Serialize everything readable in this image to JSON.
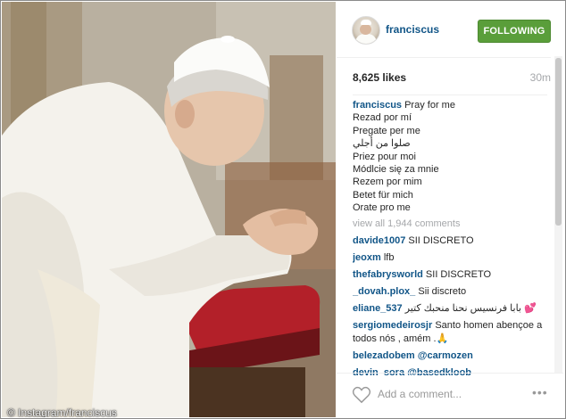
{
  "header": {
    "username": "franciscus",
    "follow_label": "FOLLOWING"
  },
  "stats": {
    "likes": "8,625 likes",
    "time": "30m"
  },
  "caption": {
    "author": "franciscus",
    "lines": [
      "Pray for me",
      "Rezad por mí",
      "Pregate per me",
      "صلوا من أجلي",
      "Priez pour moi",
      "Módlcie się za mnie",
      "Rezem por mim",
      "Betet für mich",
      "Orate pro me"
    ]
  },
  "view_all": "view all 1,944 comments",
  "comments": [
    {
      "author": "davide1007",
      "text": "SII DISCRETO"
    },
    {
      "author": "jeoxm",
      "text": "lfb"
    },
    {
      "author": "thefabrysworld",
      "text": "SII DISCRETO"
    },
    {
      "author": "_dovah.plox_",
      "text": "Sii discreto"
    },
    {
      "author": "eliane_537",
      "text": "بابا فرنسيس نحنا منحبك كتير 💕"
    },
    {
      "author": "sergiomedeirosjr",
      "text": "Santo homen abençoe a todos nós , amém .🙏"
    },
    {
      "author": "belezadobem",
      "text": "@carmozen"
    },
    {
      "author": "devin_sora",
      "text": "@basedkloob"
    }
  ],
  "footer": {
    "add_comment_placeholder": "Add a comment...",
    "more_label": "•••"
  },
  "watermark": "© Instagram/franciscus",
  "colors": {
    "username": "#125688",
    "follow_button": "#5a9e3a",
    "muted": "#a5a7aa"
  },
  "icons": [
    "heart-icon",
    "more-options-icon",
    "avatar"
  ]
}
